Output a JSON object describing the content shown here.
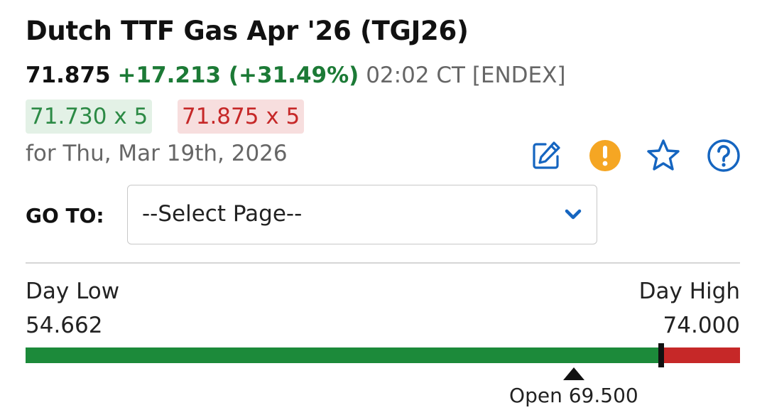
{
  "header": {
    "title": "Dutch TTF Gas Apr '26 (TGJ26)"
  },
  "quote": {
    "last": "71.875",
    "change": "+17.213 (+31.49%)",
    "time_source": "02:02 CT [ENDEX]"
  },
  "bid": {
    "label": "71.730 x 5",
    "color": "#2c8a45",
    "bg": "#e3f1e6"
  },
  "ask": {
    "label": "71.875 x 5",
    "color": "#c62828",
    "bg": "#f7dede"
  },
  "date_line": "for Thu, Mar 19th, 2026",
  "toolbar": {
    "icons": [
      "edit-icon",
      "alert-icon",
      "star-icon",
      "help-icon"
    ],
    "accent_color": "#1565c0",
    "alert_color": "#f5a623"
  },
  "goto": {
    "label": "GO TO:",
    "selected": "--Select Page--"
  },
  "day_range": {
    "low_label": "Day Low",
    "low_value": "54.662",
    "high_label": "Day High",
    "high_value": "74.000",
    "open_text": "Open 69.500",
    "low": 54.662,
    "high": 74.0,
    "last": 71.875,
    "open": 69.5,
    "up_color": "#1c8a3a",
    "down_color": "#c62828"
  }
}
